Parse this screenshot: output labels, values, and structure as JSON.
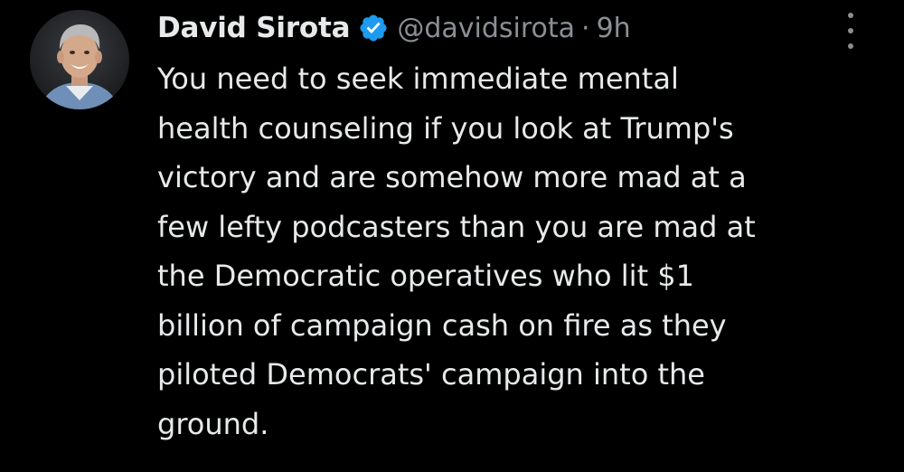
{
  "author": {
    "display_name": "David Sirota",
    "handle": "@davidsirota",
    "separator": "·",
    "time": "9h",
    "verified": true,
    "avatar_icon": "profile-photo"
  },
  "tweet": {
    "lines": [
      "You need to seek immediate mental",
      "health counseling if you look at Trump's",
      "victory and are somehow more mad at a",
      "few lefty podcasters than you are mad at",
      "the Democratic operatives who lit $1",
      "billion of campaign cash on fire as they",
      "piloted Democrats' campaign into the",
      "ground."
    ]
  },
  "menu": {
    "icon": "more-options-icon"
  },
  "colors": {
    "background": "#000000",
    "text": "#e7e9ea",
    "muted": "#8b8f94",
    "verified": "#1d9bf0"
  }
}
